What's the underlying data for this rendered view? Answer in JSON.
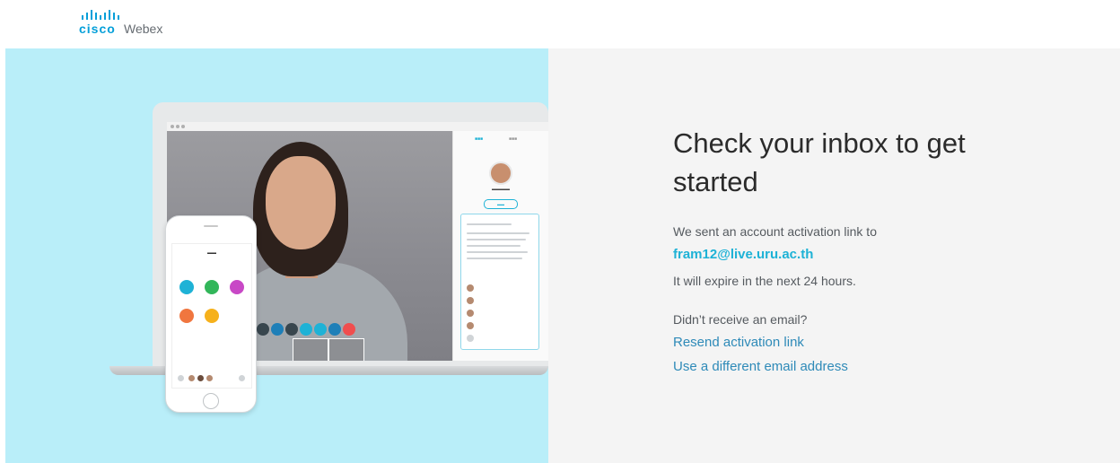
{
  "header": {
    "logo_brand": "cisco",
    "logo_product": "Webex"
  },
  "main": {
    "title": "Check your inbox to get started",
    "sent_text": "We sent an account activation link to",
    "email": "fram12@live.uru.ac.th",
    "expire_text": "It will expire in the next 24 hours.",
    "no_email_text": "Didn’t receive an email?",
    "resend_link": "Resend activation link",
    "different_email_link": "Use a different email address"
  },
  "colors": {
    "hero_bg": "#b9eef9",
    "panel_bg": "#f4f4f4",
    "email_accent": "#1eb2d6",
    "link": "#2e8ab8",
    "brand": "#049fd9"
  },
  "illustration": {
    "phone_tiles": [
      {
        "icon": "message-icon",
        "color": "#1eb2d6"
      },
      {
        "icon": "meet-icon",
        "color": "#32b65a"
      },
      {
        "icon": "whiteboard-icon",
        "color": "#c848c6"
      },
      {
        "icon": "schedule-icon",
        "color": "#f0763f"
      },
      {
        "icon": "files-icon",
        "color": "#f6b11c"
      }
    ]
  }
}
